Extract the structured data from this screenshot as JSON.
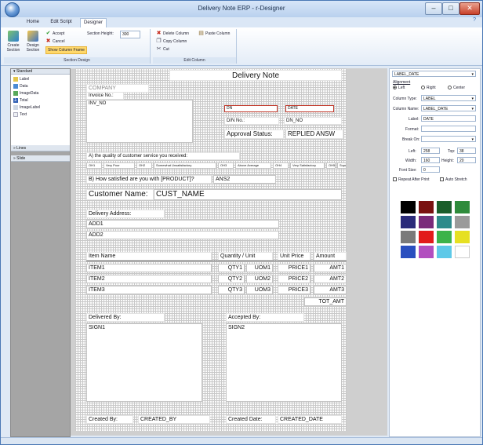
{
  "window": {
    "title": "Delivery Note ERP - r-Designer",
    "min": "–",
    "max": "□",
    "close": "✕"
  },
  "tabs": [
    {
      "label": "Home"
    },
    {
      "label": "Edit Script"
    },
    {
      "label": "Designer"
    }
  ],
  "help": "?",
  "ribbon": {
    "section_group": {
      "label": "Section Design",
      "create_section": "Create Section",
      "design_section": "Design Section",
      "accept": "Accept",
      "cancel": "Cancel",
      "show_column_frame": "Show Column Frame",
      "section_height_label": "Section Height:",
      "section_height_value": "300"
    },
    "edit_group": {
      "label": "Edit Column",
      "delete_column": "Delete Column",
      "paste_column": "Paste Column",
      "copy_column": "Copy Column",
      "cut": "Cut"
    }
  },
  "left_panel": {
    "header": "Standard",
    "items": [
      {
        "label": "Label"
      },
      {
        "label": "Data"
      },
      {
        "label": "ImageData"
      },
      {
        "label": "Total"
      },
      {
        "label": "ImageLabel"
      },
      {
        "label": "Text"
      }
    ],
    "accordions": [
      {
        "label": "Lines"
      },
      {
        "label": "Slide"
      }
    ]
  },
  "report": {
    "title": "Delivery Note",
    "company": "COMPANY",
    "invoice_label": "Invoice No.:",
    "inv_no": "INV_NO",
    "dn_left_sel": "DN",
    "dn_right_sel": "DATE",
    "dn_no_label": "D/N No.:",
    "dn_no": "DN_NO",
    "approval_label": "Approval Status:",
    "approval_value": "REPLIED ANSW",
    "question_a": "A) the quality of customer service you received:",
    "ratings": [
      "OH1",
      "Very Poor",
      "OH2",
      "Somewhat Unsatisfactory",
      "OH3",
      "Above Average",
      "OH4",
      "Very Satisfactory",
      "OH5",
      "Superior"
    ],
    "question_b": "B) How satisfied are you with [PRODUCT]?",
    "ans2": "ANS2",
    "customer_label": "Customer Name:",
    "customer_value": "CUST_NAME",
    "delivery_label": "Delivery Address:",
    "add1": "ADD1",
    "add2": "ADD2",
    "col_item": "Item Name",
    "col_qty": "Quantity / Unit",
    "col_price": "Unit Price",
    "col_amount": "Amount",
    "rows": [
      {
        "item": "ITEM1",
        "qty": "QTY1",
        "uom": "UOM1",
        "price": "PRICE1",
        "amt": "AMT1"
      },
      {
        "item": "ITEM2",
        "qty": "QTY2",
        "uom": "UOM2",
        "price": "PRICE2",
        "amt": "AMT2"
      },
      {
        "item": "ITEM3",
        "qty": "QTY3",
        "uom": "UOM3",
        "price": "PRICE3",
        "amt": "AMT3"
      }
    ],
    "tot_amt": "TOT_AMT",
    "delivered_label": "Delivered By:",
    "accepted_label": "Accepted By:",
    "sign1": "SIGN1",
    "sign2": "SIGN2",
    "created_by_label": "Created By:",
    "created_by": "CREATED_BY",
    "created_date_label": "Created Date:",
    "created_date": "CREATED_DATE"
  },
  "props": {
    "selected": "LABEL_DATE",
    "alignment_label": "Alignment",
    "align_left": "Left",
    "align_right": "Right",
    "align_center": "Center",
    "column_type_label": "Column Type:",
    "column_type": "LABEL",
    "column_name_label": "Column Name:",
    "column_name": "LABEL_DATE",
    "label_label": "Label:",
    "label_value": "DATE",
    "format_label": "Format:",
    "format_value": "",
    "break_on_label": "Break On:",
    "break_on_value": "",
    "left_label": "Left:",
    "left_value": "258",
    "top_label": "Top:",
    "top_value": "38",
    "width_label": "Width:",
    "width_value": "160",
    "height_label": "Height:",
    "height_value": "20",
    "font_size_label": "Font Size:",
    "font_size_value": "0",
    "repeat_label": "Repeat After Print",
    "autostretch_label": "Auto Stretch",
    "colors": [
      "#000000",
      "#7a1111",
      "#1b5e2b",
      "#2e8b3b",
      "#2b2b7a",
      "#7a2b7a",
      "#2e8b8b",
      "#9a9a9a",
      "#7a7a7a",
      "#e21b1b",
      "#3cb34a",
      "#e6e022",
      "#2a4fbf",
      "#b24fbf",
      "#5ec9e8",
      "#ffffff"
    ]
  }
}
